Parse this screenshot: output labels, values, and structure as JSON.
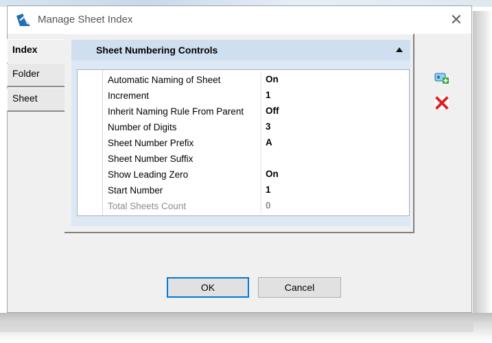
{
  "window": {
    "title": "Manage Sheet Index",
    "close_symbol": "✕"
  },
  "tabs": [
    {
      "label": "Index",
      "active": true
    },
    {
      "label": "Folder",
      "active": false
    },
    {
      "label": "Sheet",
      "active": false
    }
  ],
  "group": {
    "title": "Sheet Numbering Controls",
    "collapsed": false
  },
  "properties": [
    {
      "name": "Automatic Naming of Sheet",
      "value": "On"
    },
    {
      "name": "Increment",
      "value": "1"
    },
    {
      "name": "Inherit Naming Rule From Parent",
      "value": "Off"
    },
    {
      "name": "Number of Digits",
      "value": "3"
    },
    {
      "name": "Sheet Number Prefix",
      "value": "A"
    },
    {
      "name": "Sheet Number Suffix",
      "value": ""
    },
    {
      "name": "Show Leading Zero",
      "value": "On"
    },
    {
      "name": "Start Number",
      "value": "1"
    },
    {
      "name": "Total Sheets Count",
      "value": "0",
      "disabled": true
    }
  ],
  "side_actions": [
    {
      "icon": "add-icon"
    },
    {
      "icon": "delete-icon"
    }
  ],
  "buttons": {
    "ok": "OK",
    "cancel": "Cancel"
  },
  "colors": {
    "accent": "#0078d7",
    "group_header": "#cfdff0",
    "delete": "#e02020"
  }
}
